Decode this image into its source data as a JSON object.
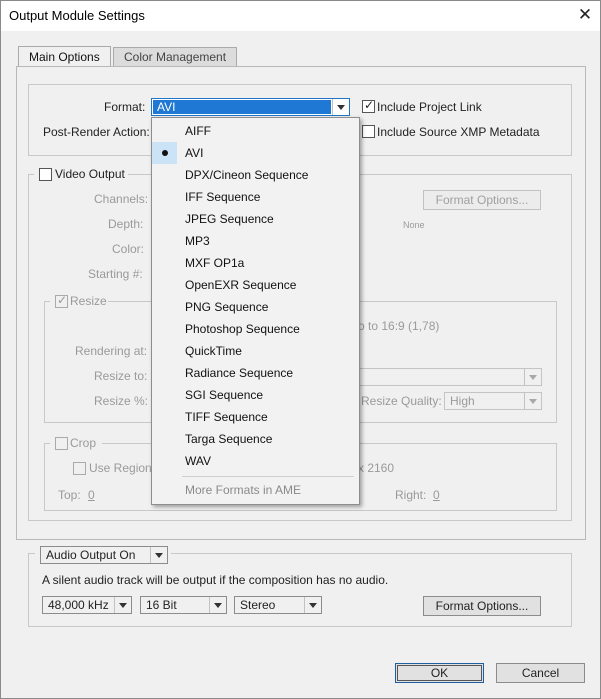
{
  "window": {
    "title": "Output Module Settings"
  },
  "tabs": [
    {
      "label": "Main Options",
      "active": true
    },
    {
      "label": "Color Management",
      "active": false
    }
  ],
  "main": {
    "format_label": "Format:",
    "format_value": "AVI",
    "post_render_label": "Post-Render Action:",
    "include_project_link": {
      "label": "Include Project Link",
      "checked": true
    },
    "include_xmp": {
      "label": "Include Source XMP Metadata",
      "checked": false
    }
  },
  "video": {
    "video_output": {
      "label": "Video Output",
      "checked": false
    },
    "channels_label": "Channels:",
    "depth_label": "Depth:",
    "color_label": "Color:",
    "starting_label": "Starting #:",
    "format_options_button": "Format Options...",
    "codec_value": "None",
    "resize": {
      "label": "Resize",
      "checked": true,
      "aspect_text": "o to 16:9 (1,78)",
      "rendering_label": "Rendering at:",
      "resize_to_label": "Resize to:",
      "resize_pct_label": "Resize %:",
      "quality_label": "Resize Quality:",
      "quality_value": "High"
    },
    "crop": {
      "label": "Crop",
      "checked": false,
      "use_region_label": "Use Region",
      "use_region_checked": false,
      "size_text": "x 2160",
      "top_label": "Top:",
      "top_value": "0",
      "right_label": "Right:",
      "right_value": "0"
    }
  },
  "audio": {
    "audio_output_value": "Audio Output On",
    "note": "A silent audio track will be output if the composition has no audio.",
    "sample_rate": "48,000 kHz",
    "bit_depth": "16 Bit",
    "channels": "Stereo",
    "format_options_button": "Format Options..."
  },
  "buttons": {
    "ok": "OK",
    "cancel": "Cancel"
  },
  "format_dropdown": {
    "items": [
      {
        "label": "AIFF"
      },
      {
        "label": "AVI",
        "selected": true
      },
      {
        "label": "DPX/Cineon Sequence"
      },
      {
        "label": "IFF Sequence"
      },
      {
        "label": "JPEG Sequence"
      },
      {
        "label": "MP3"
      },
      {
        "label": "MXF OP1a"
      },
      {
        "label": "OpenEXR Sequence"
      },
      {
        "label": "PNG Sequence"
      },
      {
        "label": "Photoshop Sequence"
      },
      {
        "label": "QuickTime"
      },
      {
        "label": "Radiance Sequence"
      },
      {
        "label": "SGI Sequence"
      },
      {
        "label": "TIFF Sequence"
      },
      {
        "label": "Targa Sequence"
      },
      {
        "label": "WAV"
      }
    ],
    "more": "More Formats in AME"
  }
}
